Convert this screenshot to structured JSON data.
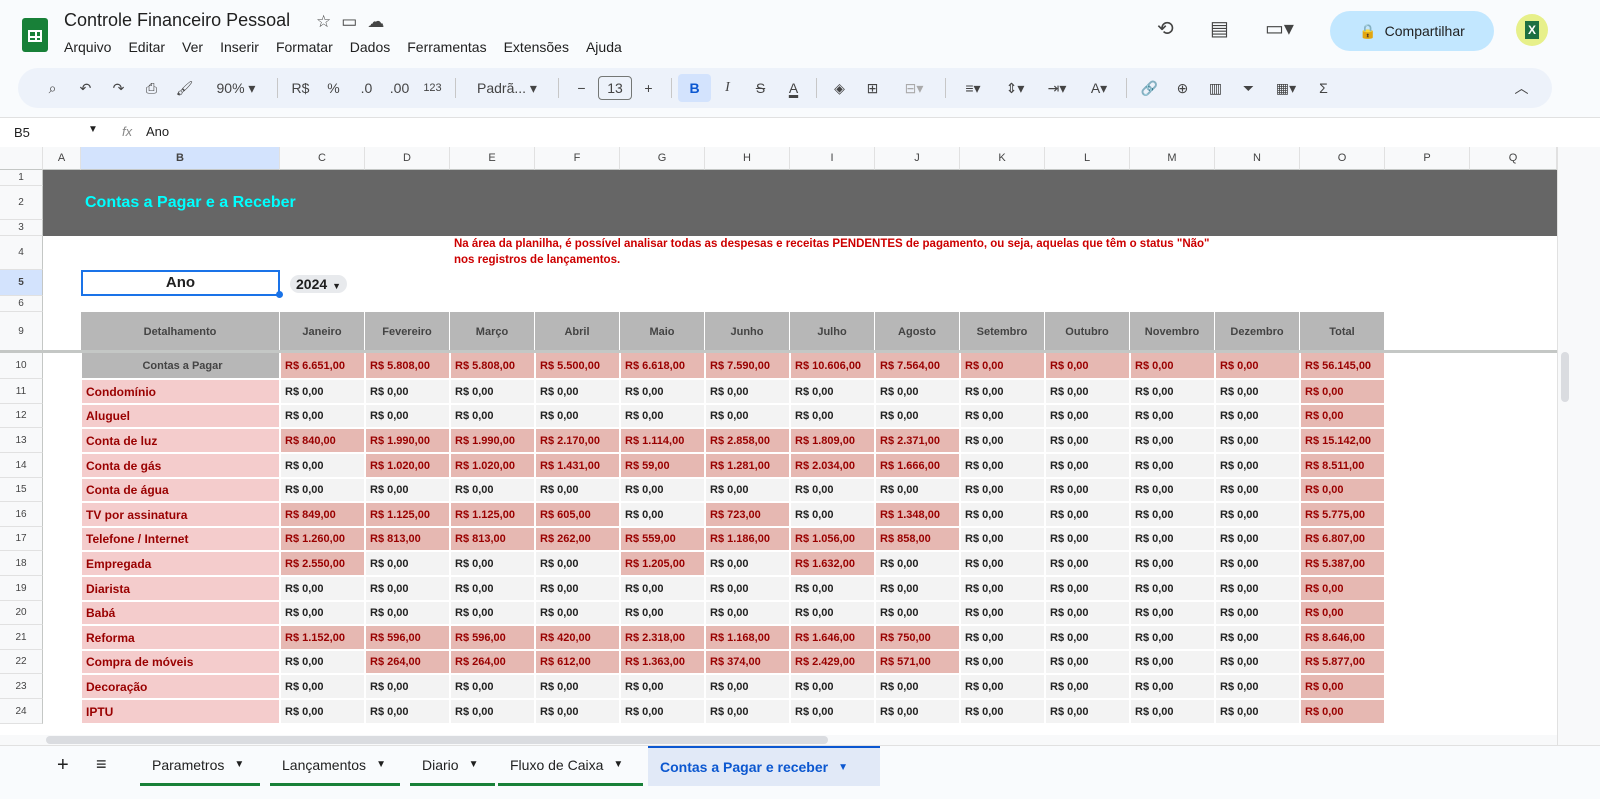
{
  "app": {
    "title": "Controle Financeiro Pessoal",
    "menu": [
      "Arquivo",
      "Editar",
      "Ver",
      "Inserir",
      "Formatar",
      "Dados",
      "Ferramentas",
      "Extensões",
      "Ajuda"
    ],
    "share_label": "Compartilhar",
    "avatar_label": "X"
  },
  "toolbar": {
    "zoom": "90%",
    "currency": "R$",
    "percent": "%",
    "dec_less": ".0",
    "dec_more": ".00",
    "number_format": "123",
    "font": "Padrã...",
    "font_size": "13",
    "bold": "B",
    "italic": "I",
    "strike": "S",
    "text_color": "A",
    "sum": "Σ"
  },
  "formula_bar": {
    "cell_ref": "B5",
    "fx": "fx",
    "value": "Ano"
  },
  "columns": [
    "A",
    "B",
    "C",
    "D",
    "E",
    "F",
    "G",
    "H",
    "I",
    "J",
    "K",
    "L",
    "M",
    "N",
    "O",
    "P",
    "Q"
  ],
  "rows": [
    "1",
    "2",
    "3",
    "4",
    "5",
    "6",
    "9",
    "10",
    "11",
    "12",
    "13",
    "14",
    "15",
    "16",
    "17",
    "18",
    "19",
    "20",
    "21",
    "22",
    "23",
    "24"
  ],
  "sheet": {
    "banner_title": "Contas a Pagar e a Receber",
    "note_line1": "Na área da planilha, é possível analisar todas as despesas e receitas PENDENTES de pagamento, ou seja, aquelas que têm o status \"Não\"",
    "note_line2": "nos registros de lançamentos.",
    "year_label": "Ano",
    "year_value": "2024",
    "headers": [
      "Detalhamento",
      "Janeiro",
      "Fevereiro",
      "Março",
      "Abril",
      "Maio",
      "Junho",
      "Julho",
      "Agosto",
      "Setembro",
      "Outubro",
      "Novembro",
      "Dezembro",
      "Total"
    ],
    "data": [
      [
        "Contas a Pagar",
        "R$ 6.651,00",
        "R$ 5.808,00",
        "R$ 5.808,00",
        "R$ 5.500,00",
        "R$ 6.618,00",
        "R$ 7.590,00",
        "R$ 10.606,00",
        "R$ 7.564,00",
        "R$ 0,00",
        "R$ 0,00",
        "R$ 0,00",
        "R$ 0,00",
        "R$ 56.145,00"
      ],
      [
        "Condomínio",
        "R$ 0,00",
        "R$ 0,00",
        "R$ 0,00",
        "R$ 0,00",
        "R$ 0,00",
        "R$ 0,00",
        "R$ 0,00",
        "R$ 0,00",
        "R$ 0,00",
        "R$ 0,00",
        "R$ 0,00",
        "R$ 0,00",
        "R$ 0,00"
      ],
      [
        "Aluguel",
        "R$ 0,00",
        "R$ 0,00",
        "R$ 0,00",
        "R$ 0,00",
        "R$ 0,00",
        "R$ 0,00",
        "R$ 0,00",
        "R$ 0,00",
        "R$ 0,00",
        "R$ 0,00",
        "R$ 0,00",
        "R$ 0,00",
        "R$ 0,00"
      ],
      [
        "Conta de luz",
        "R$ 840,00",
        "R$ 1.990,00",
        "R$ 1.990,00",
        "R$ 2.170,00",
        "R$ 1.114,00",
        "R$ 2.858,00",
        "R$ 1.809,00",
        "R$ 2.371,00",
        "R$ 0,00",
        "R$ 0,00",
        "R$ 0,00",
        "R$ 0,00",
        "R$ 15.142,00"
      ],
      [
        "Conta de gás",
        "R$ 0,00",
        "R$ 1.020,00",
        "R$ 1.020,00",
        "R$ 1.431,00",
        "R$ 59,00",
        "R$ 1.281,00",
        "R$ 2.034,00",
        "R$ 1.666,00",
        "R$ 0,00",
        "R$ 0,00",
        "R$ 0,00",
        "R$ 0,00",
        "R$ 8.511,00"
      ],
      [
        "Conta de água",
        "R$ 0,00",
        "R$ 0,00",
        "R$ 0,00",
        "R$ 0,00",
        "R$ 0,00",
        "R$ 0,00",
        "R$ 0,00",
        "R$ 0,00",
        "R$ 0,00",
        "R$ 0,00",
        "R$ 0,00",
        "R$ 0,00",
        "R$ 0,00"
      ],
      [
        "TV por assinatura",
        "R$ 849,00",
        "R$ 1.125,00",
        "R$ 1.125,00",
        "R$ 605,00",
        "R$ 0,00",
        "R$ 723,00",
        "R$ 0,00",
        "R$ 1.348,00",
        "R$ 0,00",
        "R$ 0,00",
        "R$ 0,00",
        "R$ 0,00",
        "R$ 5.775,00"
      ],
      [
        "Telefone / Internet",
        "R$ 1.260,00",
        "R$ 813,00",
        "R$ 813,00",
        "R$ 262,00",
        "R$ 559,00",
        "R$ 1.186,00",
        "R$ 1.056,00",
        "R$ 858,00",
        "R$ 0,00",
        "R$ 0,00",
        "R$ 0,00",
        "R$ 0,00",
        "R$ 6.807,00"
      ],
      [
        "Empregada",
        "R$ 2.550,00",
        "R$ 0,00",
        "R$ 0,00",
        "R$ 0,00",
        "R$ 1.205,00",
        "R$ 0,00",
        "R$ 1.632,00",
        "R$ 0,00",
        "R$ 0,00",
        "R$ 0,00",
        "R$ 0,00",
        "R$ 0,00",
        "R$ 5.387,00"
      ],
      [
        "Diarista",
        "R$ 0,00",
        "R$ 0,00",
        "R$ 0,00",
        "R$ 0,00",
        "R$ 0,00",
        "R$ 0,00",
        "R$ 0,00",
        "R$ 0,00",
        "R$ 0,00",
        "R$ 0,00",
        "R$ 0,00",
        "R$ 0,00",
        "R$ 0,00"
      ],
      [
        "Babá",
        "R$ 0,00",
        "R$ 0,00",
        "R$ 0,00",
        "R$ 0,00",
        "R$ 0,00",
        "R$ 0,00",
        "R$ 0,00",
        "R$ 0,00",
        "R$ 0,00",
        "R$ 0,00",
        "R$ 0,00",
        "R$ 0,00",
        "R$ 0,00"
      ],
      [
        "Reforma",
        "R$ 1.152,00",
        "R$ 596,00",
        "R$ 596,00",
        "R$ 420,00",
        "R$ 2.318,00",
        "R$ 1.168,00",
        "R$ 1.646,00",
        "R$ 750,00",
        "R$ 0,00",
        "R$ 0,00",
        "R$ 0,00",
        "R$ 0,00",
        "R$ 8.646,00"
      ],
      [
        "Compra de móveis",
        "R$ 0,00",
        "R$ 264,00",
        "R$ 264,00",
        "R$ 612,00",
        "R$ 1.363,00",
        "R$ 374,00",
        "R$ 2.429,00",
        "R$ 571,00",
        "R$ 0,00",
        "R$ 0,00",
        "R$ 0,00",
        "R$ 0,00",
        "R$ 5.877,00"
      ],
      [
        "Decoração",
        "R$ 0,00",
        "R$ 0,00",
        "R$ 0,00",
        "R$ 0,00",
        "R$ 0,00",
        "R$ 0,00",
        "R$ 0,00",
        "R$ 0,00",
        "R$ 0,00",
        "R$ 0,00",
        "R$ 0,00",
        "R$ 0,00",
        "R$ 0,00"
      ],
      [
        "IPTU",
        "R$ 0,00",
        "R$ 0,00",
        "R$ 0,00",
        "R$ 0,00",
        "R$ 0,00",
        "R$ 0,00",
        "R$ 0,00",
        "R$ 0,00",
        "R$ 0,00",
        "R$ 0,00",
        "R$ 0,00",
        "R$ 0,00",
        "R$ 0,00"
      ]
    ]
  },
  "tabs": [
    {
      "label": "Parametros"
    },
    {
      "label": "Lançamentos"
    },
    {
      "label": "Diario"
    },
    {
      "label": "Fluxo de Caixa"
    },
    {
      "label": "Contas a Pagar e receber",
      "active": true
    }
  ],
  "colors": {
    "banner": "#666666",
    "banner_text": "#00ffff",
    "note": "#cc0000",
    "pink": "#e6b8b2",
    "label_bg": "#f4cccc",
    "header_bg": "#b7b7b7",
    "active_tab": "#0b57d0"
  }
}
